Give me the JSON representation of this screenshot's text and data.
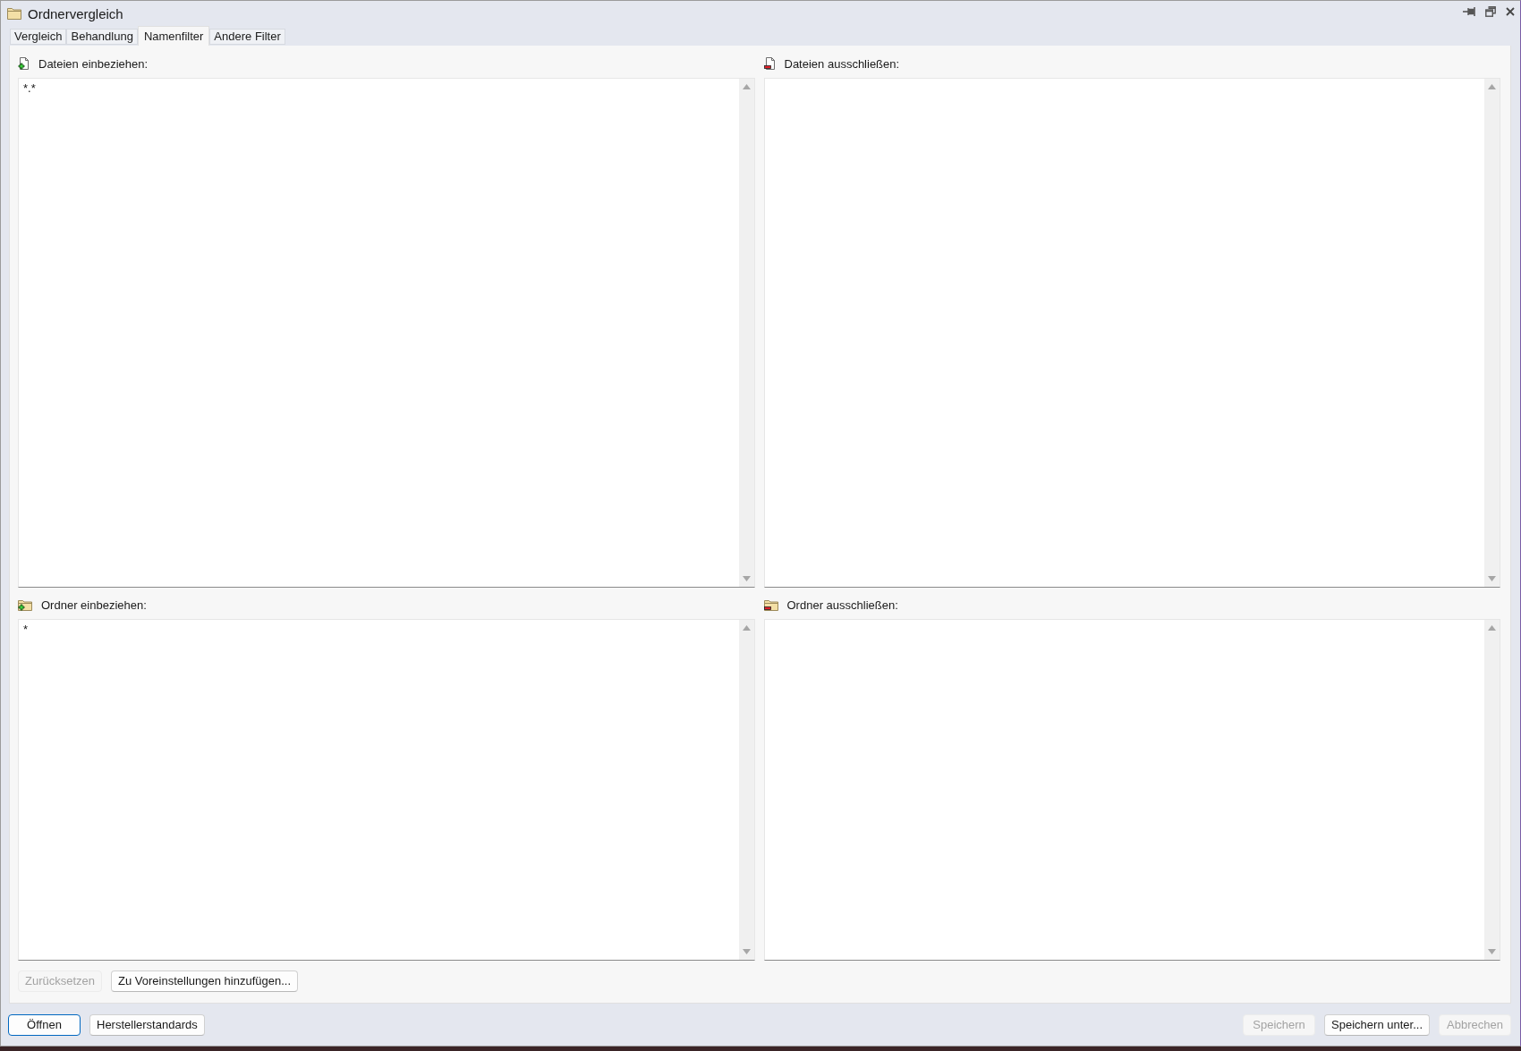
{
  "window": {
    "title": "Ordnervergleich"
  },
  "tabs": [
    {
      "label": "Vergleich",
      "selected": false
    },
    {
      "label": "Behandlung",
      "selected": false
    },
    {
      "label": "Namenfilter",
      "selected": true
    },
    {
      "label": "Andere Filter",
      "selected": false
    }
  ],
  "filters": [
    {
      "kind": "file-include",
      "label": "Dateien einbeziehen:",
      "value": "*.*"
    },
    {
      "kind": "file-exclude",
      "label": "Dateien ausschließen:"
    },
    {
      "kind": "folder-include",
      "label": "Ordner einbeziehen:",
      "value": "*"
    },
    {
      "kind": "folder-exclude",
      "label": "Ordner ausschließen:"
    }
  ],
  "panel_buttons": [
    {
      "label": "Zurücksetzen",
      "disabled": true
    },
    {
      "label": "Zu Voreinstellungen hinzufügen...",
      "disabled": false
    }
  ],
  "footer": {
    "left_buttons": [
      {
        "label": "Öffnen",
        "default": true,
        "disabled": false
      },
      {
        "label": "Herstellerstandards",
        "default": false,
        "disabled": false
      }
    ],
    "right_buttons": [
      {
        "label": "Speichern",
        "default": false,
        "disabled": true
      },
      {
        "label": "Speichern unter...",
        "default": false,
        "disabled": false
      },
      {
        "label": "Abbrechen",
        "default": false,
        "disabled": true
      }
    ]
  }
}
